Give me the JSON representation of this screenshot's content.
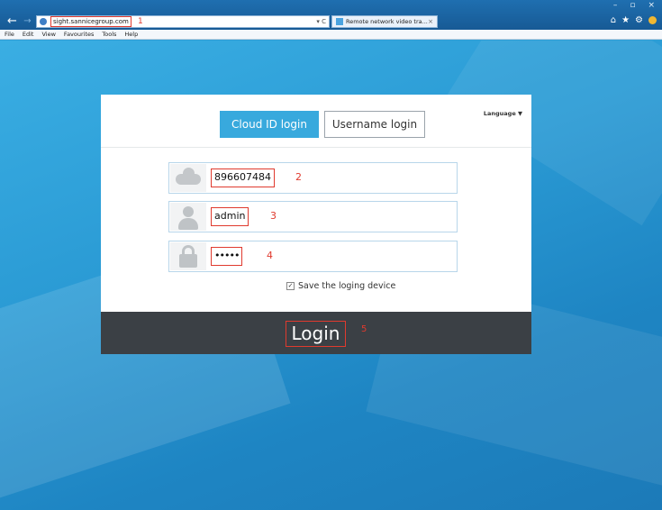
{
  "browser": {
    "address_url": "sight.sannicegroup.com",
    "address_annotation": "1",
    "address_controls": "▾ C",
    "tab_title": "Remote network video tra...",
    "tab_close": "×",
    "window_controls": [
      "–",
      "▫",
      "×"
    ],
    "menu": [
      "File",
      "Edit",
      "View",
      "Favourites",
      "Tools",
      "Help"
    ]
  },
  "login": {
    "tabs": {
      "cloud": "Cloud ID login",
      "username": "Username login"
    },
    "language_label": "Language ▼",
    "fields": {
      "cloud_id": {
        "value": "896607484",
        "annotation": "2"
      },
      "username": {
        "value": "admin",
        "annotation": "3"
      },
      "password": {
        "value": "•••••",
        "annotation": "4"
      }
    },
    "save_label": "Save the loging device",
    "save_checked": true,
    "login_button": "Login",
    "login_annotation": "5"
  },
  "colors": {
    "accent": "#38a9dd",
    "annotation_red": "#e03a2e",
    "login_bar": "#3b4045"
  }
}
